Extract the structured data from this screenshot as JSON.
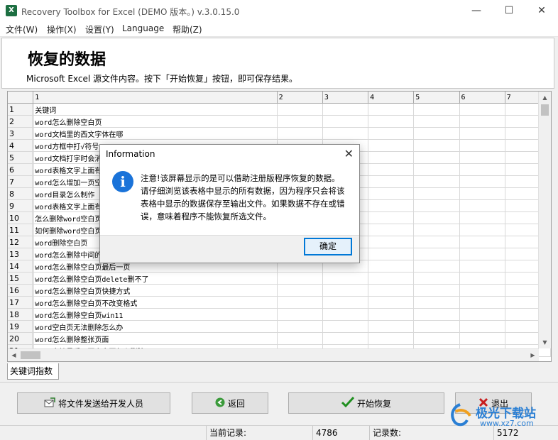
{
  "window": {
    "title": "Recovery Toolbox for Excel (DEMO 版本。) v.3.0.15.0",
    "app_icon_letter": "X"
  },
  "menu": [
    "文件(W)",
    "操作(X)",
    "设置(Y)",
    "Language",
    "帮助(Z)"
  ],
  "header": {
    "title": "恢复的数据",
    "subtitle": "Microsoft Excel 源文件内容。按下「开始恢复」按钮，即可保存结果。"
  },
  "grid": {
    "columns": [
      "1",
      "2",
      "3",
      "4",
      "5",
      "6",
      "7"
    ],
    "rows": [
      {
        "n": "1",
        "c1": "关键词"
      },
      {
        "n": "2",
        "c1": "word怎么删除空白页"
      },
      {
        "n": "3",
        "c1": "word文档里的西文字体在哪"
      },
      {
        "n": "4",
        "c1": "word方框中打√符号"
      },
      {
        "n": "5",
        "c1": "word文档打字时会消失"
      },
      {
        "n": "6",
        "c1": "word表格文字上面有空白"
      },
      {
        "n": "7",
        "c1": "word怎么增加一页空白页"
      },
      {
        "n": "8",
        "c1": "word目录怎么制作"
      },
      {
        "n": "9",
        "c1": "word表格文字上面有空白"
      },
      {
        "n": "10",
        "c1": "怎么删除word空白页"
      },
      {
        "n": "11",
        "c1": "如何删除word空白页"
      },
      {
        "n": "12",
        "c1": "word删除空白页"
      },
      {
        "n": "13",
        "c1": "word怎么删除中间的空白页"
      },
      {
        "n": "14",
        "c1": "word怎么删除空白页最后一页"
      },
      {
        "n": "15",
        "c1": "word怎么删除空白页delete删不了"
      },
      {
        "n": "16",
        "c1": "word怎么删除空白页快捷方式"
      },
      {
        "n": "17",
        "c1": "word怎么删除空白页不改变格式"
      },
      {
        "n": "18",
        "c1": "word怎么删除空白页win11"
      },
      {
        "n": "19",
        "c1": "word空白页无法删除怎么办"
      },
      {
        "n": "20",
        "c1": "word怎么删除整张页面"
      },
      {
        "n": "21",
        "c1": "word文档最后一页空白页怎么删除"
      }
    ]
  },
  "sheet_tab": "关键词指数",
  "buttons": {
    "send": "将文件发送给开发人员",
    "back": "返回",
    "start": "开始恢复",
    "exit": "退出"
  },
  "status": {
    "current_label": "当前记录:",
    "current_value": "4786",
    "total_label": "记录数:",
    "total_value": "5172"
  },
  "dialog": {
    "title": "Information",
    "message": "注意!该屏幕显示的是可以借助注册版程序恢复的数据。请仔细浏览该表格中显示的所有数据，因为程序只会将该表格中显示的数据保存至输出文件。如果数据不存在或错误，意味着程序不能恢复所选文件。",
    "ok": "确定"
  },
  "watermark": {
    "text": "极光下载站",
    "url": "www.xz7.com"
  }
}
